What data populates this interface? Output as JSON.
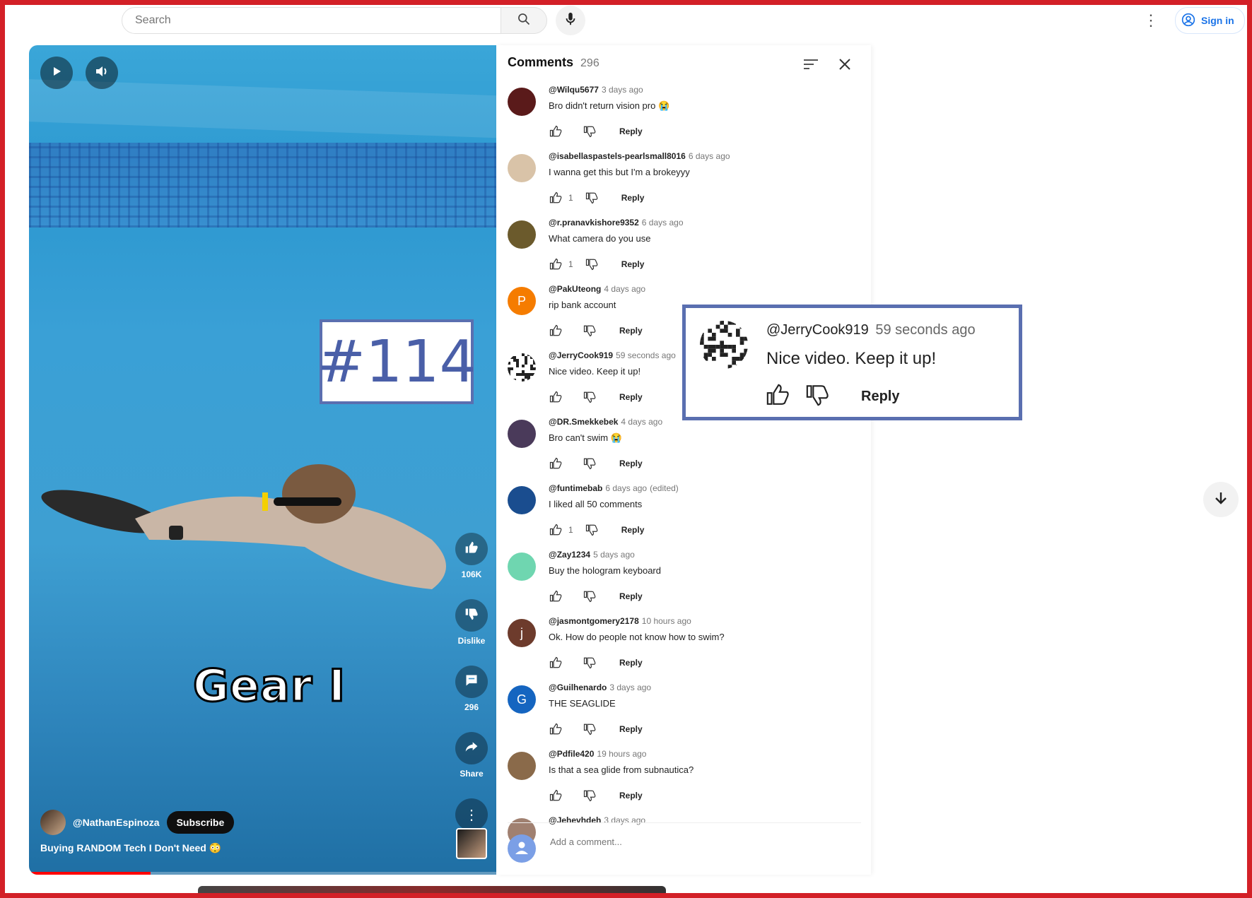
{
  "topbar": {
    "search_placeholder": "Search",
    "signin_label": "Sign in"
  },
  "video": {
    "overlay_text": "Gear I",
    "channel_name": "@NathanEspinoza",
    "subscribe_label": "Subscribe",
    "title": "Buying RANDOM Tech I Don't Need 😳",
    "like_count": "106K",
    "dislike_label": "Dislike",
    "comment_count": "296",
    "share_label": "Share",
    "progress": 0.26
  },
  "comments": {
    "title": "Comments",
    "count": "296",
    "items": [
      {
        "user": "@Wilqu5677",
        "time": "3 days ago",
        "text": "Bro didn't return vision pro 😭",
        "likes": "",
        "avatar_color": "#5a1a1a"
      },
      {
        "user": "@isabellaspastels-pearlsmall8016",
        "time": "6 days ago",
        "text": "I wanna get this but I'm a brokeyyy",
        "likes": "1",
        "avatar_color": "#d9c3a8"
      },
      {
        "user": "@r.pranavkishore9352",
        "time": "6 days ago",
        "text": "What camera do you use",
        "likes": "1",
        "avatar_color": "#6b5a2c"
      },
      {
        "user": "@PakUteong",
        "time": "4 days ago",
        "text": "rip bank account",
        "likes": "",
        "avatar_color": "#f57c00",
        "avatar_letter": "P"
      },
      {
        "user": "@JerryCook919",
        "time": "59 seconds ago",
        "text": "Nice video. Keep it up!",
        "likes": "",
        "avatar_color": "#ffffff"
      },
      {
        "user": "@DR.Smekkebek",
        "time": "4 days ago",
        "text": "Bro can't swim 😭",
        "likes": "",
        "avatar_color": "#4a3a5a"
      },
      {
        "user": "@funtimebab",
        "time": "6 days ago",
        "edited": "(edited)",
        "text": "I liked all 50 comments",
        "likes": "1",
        "avatar_color": "#1a4d8f"
      },
      {
        "user": "@Zay1234",
        "time": "5 days ago",
        "text": "Buy the hologram keyboard",
        "likes": "",
        "avatar_color": "#6fd6b0"
      },
      {
        "user": "@jasmontgomery2178",
        "time": "10 hours ago",
        "text": "Ok. How do people not know how to swim?",
        "likes": "",
        "avatar_color": "#6d3b2c",
        "avatar_letter": "j"
      },
      {
        "user": "@Guilhenardo",
        "time": "3 days ago",
        "text": "THE SEAGLIDE",
        "likes": "",
        "avatar_color": "#1565c0",
        "avatar_letter": "G"
      },
      {
        "user": "@Pdfile420",
        "time": "19 hours ago",
        "text": "Is that a sea glide from subnautica?",
        "likes": "",
        "avatar_color": "#8a6a4a"
      },
      {
        "user": "@Jehevhdeh",
        "time": "3 days ago",
        "text": "",
        "likes": "",
        "avatar_color": "#a08070"
      }
    ],
    "reply_label": "Reply",
    "add_placeholder": "Add a comment..."
  },
  "annotation": {
    "tag": "#114",
    "zoom_user": "@JerryCook919",
    "zoom_time": "59 seconds ago",
    "zoom_text": "Nice video. Keep it up!",
    "zoom_reply": "Reply"
  }
}
